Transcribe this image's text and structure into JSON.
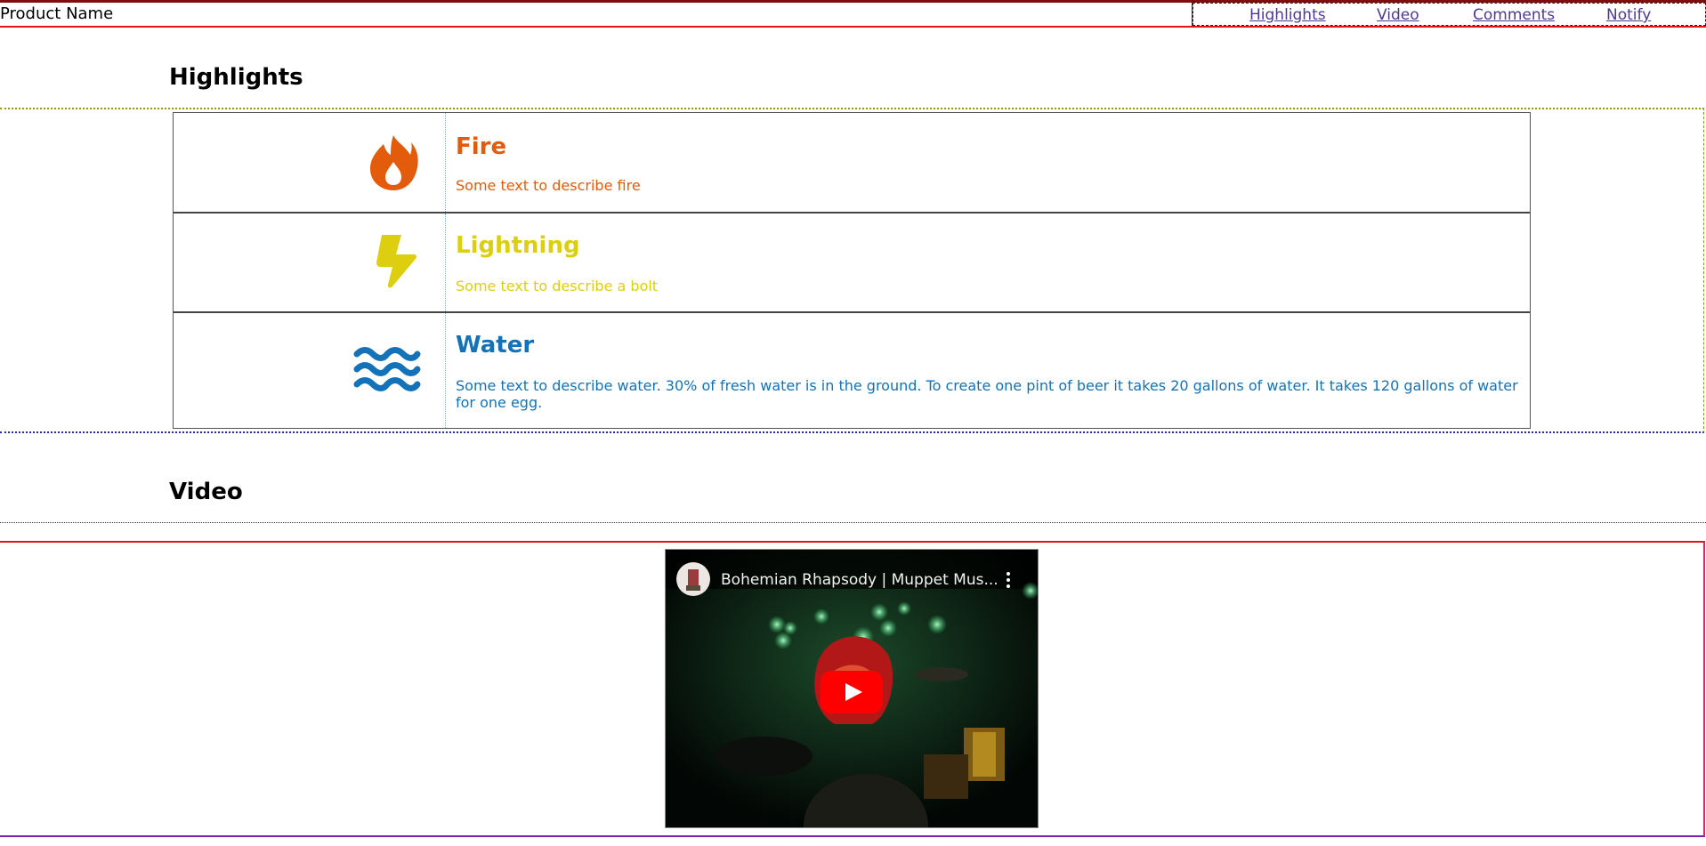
{
  "header": {
    "product_name": "Product Name",
    "nav": [
      {
        "label": "Highlights"
      },
      {
        "label": "Video"
      },
      {
        "label": "Comments"
      },
      {
        "label": "Notify"
      }
    ]
  },
  "highlights": {
    "title": "Highlights",
    "items": [
      {
        "icon": "fire-icon",
        "title": "Fire",
        "description": "Some text to describe fire",
        "color": "#e25c0c"
      },
      {
        "icon": "lightning-icon",
        "title": "Lightning",
        "description": "Some text to describe a bolt",
        "color": "#ddcf0f"
      },
      {
        "icon": "water-icon",
        "title": "Water",
        "description": "Some text to describe water. 30% of fresh water is in the ground. To create one pint of beer it takes 20 gallons of water. It takes 120 gallons of water for one egg.",
        "color": "#1372b8"
      }
    ]
  },
  "video": {
    "title": "Video",
    "player": {
      "video_title": "Bohemian Rhapsody | Muppet Mus...",
      "icons": [
        "channel-avatar-icon",
        "more-options-icon",
        "play-icon"
      ]
    }
  }
}
